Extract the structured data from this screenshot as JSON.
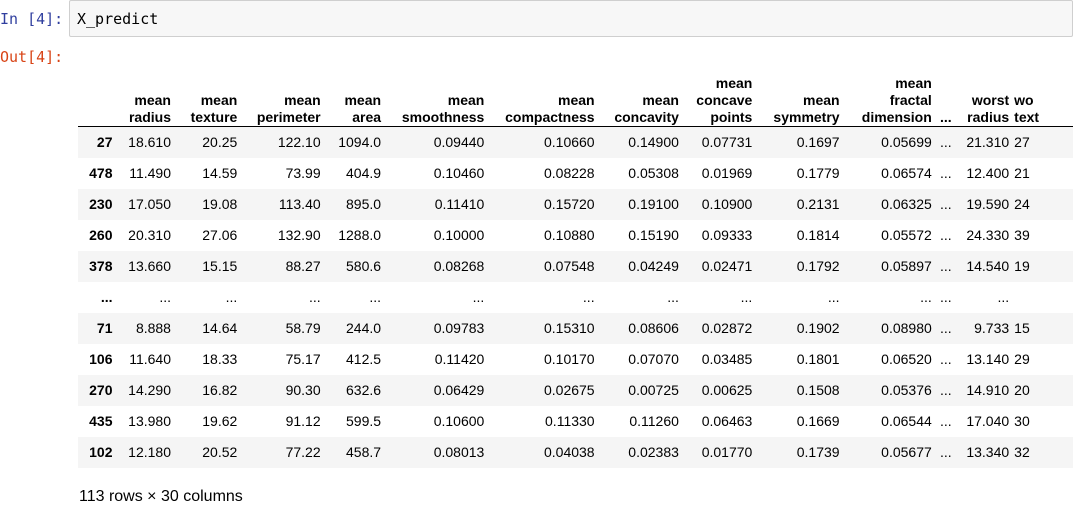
{
  "cell": {
    "in_prompt": "In [4]:",
    "out_prompt": "Out[4]:",
    "code": "X_predict"
  },
  "dataframe": {
    "columns": [
      "mean\nradius",
      "mean\ntexture",
      "mean\nperimeter",
      "mean\narea",
      "mean\nsmoothness",
      "mean\ncompactness",
      "mean\nconcavity",
      "mean\nconcave\npoints",
      "mean\nsymmetry",
      "mean\nfractal\ndimension",
      "...",
      "worst\nradius",
      "wo\ntext"
    ],
    "rows": [
      {
        "index": "27",
        "values": [
          "18.610",
          "20.25",
          "122.10",
          "1094.0",
          "0.09440",
          "0.10660",
          "0.14900",
          "0.07731",
          "0.1697",
          "0.05699",
          "...",
          "21.310",
          "27"
        ]
      },
      {
        "index": "478",
        "values": [
          "11.490",
          "14.59",
          "73.99",
          "404.9",
          "0.10460",
          "0.08228",
          "0.05308",
          "0.01969",
          "0.1779",
          "0.06574",
          "...",
          "12.400",
          "21"
        ]
      },
      {
        "index": "230",
        "values": [
          "17.050",
          "19.08",
          "113.40",
          "895.0",
          "0.11410",
          "0.15720",
          "0.19100",
          "0.10900",
          "0.2131",
          "0.06325",
          "...",
          "19.590",
          "24"
        ]
      },
      {
        "index": "260",
        "values": [
          "20.310",
          "27.06",
          "132.90",
          "1288.0",
          "0.10000",
          "0.10880",
          "0.15190",
          "0.09333",
          "0.1814",
          "0.05572",
          "...",
          "24.330",
          "39"
        ]
      },
      {
        "index": "378",
        "values": [
          "13.660",
          "15.15",
          "88.27",
          "580.6",
          "0.08268",
          "0.07548",
          "0.04249",
          "0.02471",
          "0.1792",
          "0.05897",
          "...",
          "14.540",
          "19"
        ]
      },
      {
        "index": "...",
        "values": [
          "...",
          "...",
          "...",
          "...",
          "...",
          "...",
          "...",
          "...",
          "...",
          "...",
          "...",
          "...",
          ""
        ]
      },
      {
        "index": "71",
        "values": [
          "8.888",
          "14.64",
          "58.79",
          "244.0",
          "0.09783",
          "0.15310",
          "0.08606",
          "0.02872",
          "0.1902",
          "0.08980",
          "...",
          "9.733",
          "15"
        ]
      },
      {
        "index": "106",
        "values": [
          "11.640",
          "18.33",
          "75.17",
          "412.5",
          "0.11420",
          "0.10170",
          "0.07070",
          "0.03485",
          "0.1801",
          "0.06520",
          "...",
          "13.140",
          "29"
        ]
      },
      {
        "index": "270",
        "values": [
          "14.290",
          "16.82",
          "90.30",
          "632.6",
          "0.06429",
          "0.02675",
          "0.00725",
          "0.00625",
          "0.1508",
          "0.05376",
          "...",
          "14.910",
          "20"
        ]
      },
      {
        "index": "435",
        "values": [
          "13.980",
          "19.62",
          "91.12",
          "599.5",
          "0.10600",
          "0.11330",
          "0.11260",
          "0.06463",
          "0.1669",
          "0.06544",
          "...",
          "17.040",
          "30"
        ]
      },
      {
        "index": "102",
        "values": [
          "12.180",
          "20.52",
          "77.22",
          "458.7",
          "0.08013",
          "0.04038",
          "0.02383",
          "0.01770",
          "0.1739",
          "0.05677",
          "...",
          "13.340",
          "32"
        ]
      }
    ],
    "summary": "113 rows × 30 columns"
  }
}
